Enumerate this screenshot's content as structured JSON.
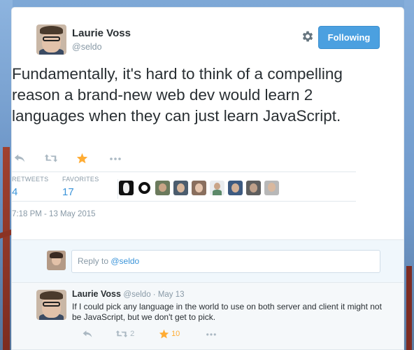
{
  "tweet": {
    "author_name": "Laurie Voss",
    "author_handle": "@seldo",
    "follow_label": "Following",
    "text": "Fundamentally, it's hard to think of a compelling reason a brand-new web dev would learn 2 languages when they can just learn JavaScript.",
    "stats": {
      "retweets_label": "RETWEETS",
      "retweets": "4",
      "favorites_label": "FAVORITES",
      "favorites": "17"
    },
    "timestamp": "7:18 PM - 13 May 2015",
    "favorited_by_count_shown": 9
  },
  "reply_box": {
    "prefix": "Reply to ",
    "mention": "@seldo"
  },
  "reply": {
    "author_name": "Laurie Voss",
    "author_handle": "@seldo",
    "separator": " · ",
    "date": "May 13",
    "text": "If I could pick any language in the world to use on both server and client it might not be JavaScript, but we don't get to pick.",
    "retweets": "2",
    "favorites": "10"
  },
  "colors": {
    "accent": "#4ba0e0",
    "link": "#3b94d9",
    "favorite": "#ffac33",
    "muted": "#8899a6"
  },
  "icons": [
    "gear-icon",
    "reply-icon",
    "retweet-icon",
    "star-icon",
    "more-icon"
  ]
}
